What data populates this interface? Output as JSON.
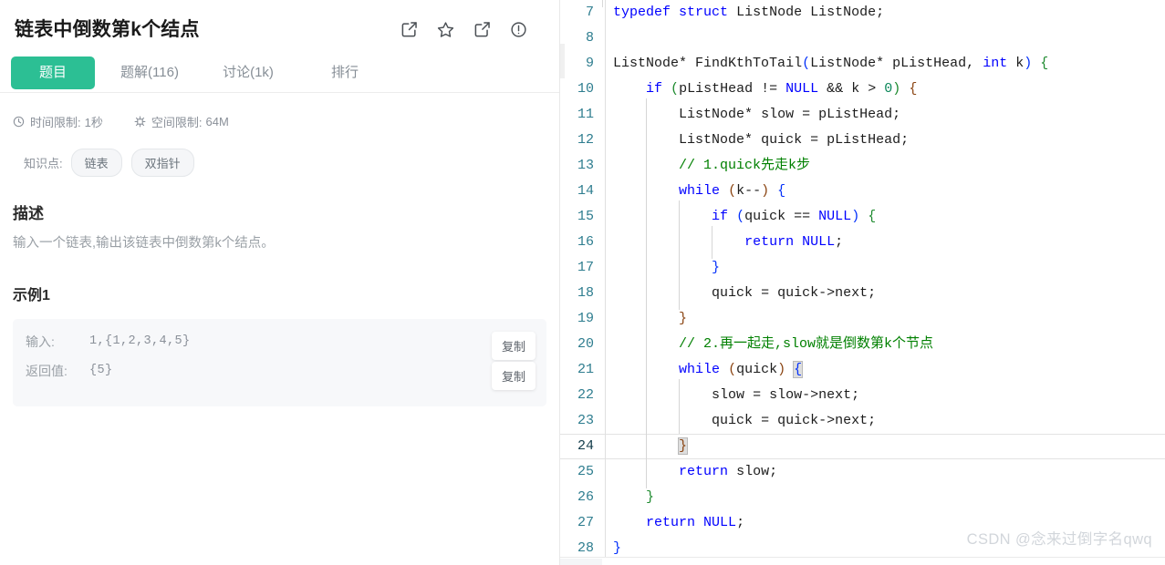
{
  "problem": {
    "title": "链表中倒数第k个结点",
    "header_icons": [
      {
        "name": "edit-icon",
        "label": "编辑"
      },
      {
        "name": "star-icon",
        "label": "收藏"
      },
      {
        "name": "share-icon",
        "label": "分享"
      },
      {
        "name": "info-icon",
        "label": "反馈"
      }
    ],
    "tabs": [
      {
        "label": "题目",
        "active": true
      },
      {
        "label": "题解(116)",
        "active": false
      },
      {
        "label": "讨论(1k)",
        "active": false
      },
      {
        "label": "排行",
        "active": false
      }
    ],
    "meta": [
      {
        "icon": "clock-icon",
        "label": "时间限制:",
        "value": "1秒"
      },
      {
        "icon": "chip-icon",
        "label": "空间限制:",
        "value": "64M"
      }
    ],
    "knowledge": {
      "label": "知识点:",
      "tags": [
        "链表",
        "双指针"
      ]
    },
    "description": {
      "heading": "描述",
      "body": "输入一个链表,输出该链表中倒数第k个结点。"
    },
    "example": {
      "heading": "示例1",
      "rows": [
        {
          "key": "输入:",
          "value": "1,{1,2,3,4,5}",
          "copy_label": "复制"
        },
        {
          "key": "返回值:",
          "value": "{5}",
          "copy_label": "复制"
        }
      ]
    }
  },
  "editor": {
    "language": "c",
    "active_line": 24,
    "accent_color": "#2cbf94",
    "colors": {
      "keyword": "#0000ff",
      "comment": "#008000",
      "number": "#098658",
      "paren_green": "#1d8a2e",
      "paren_blue": "#0431fa",
      "paren_brown": "#8b4513",
      "line_number": "#2e7d8f",
      "plain": "#1c1c1c"
    },
    "lines": [
      {
        "n": 7,
        "code": "typedef struct ListNode ListNode;"
      },
      {
        "n": 8,
        "code": ""
      },
      {
        "n": 9,
        "code": "ListNode* FindKthToTail(ListNode* pListHead, int k) {"
      },
      {
        "n": 10,
        "code": "    if (pListHead != NULL && k > 0) {"
      },
      {
        "n": 11,
        "code": "        ListNode* slow = pListHead;"
      },
      {
        "n": 12,
        "code": "        ListNode* quick = pListHead;"
      },
      {
        "n": 13,
        "code": "        // 1.quick先走k步"
      },
      {
        "n": 14,
        "code": "        while (k--) {"
      },
      {
        "n": 15,
        "code": "            if (quick == NULL) {"
      },
      {
        "n": 16,
        "code": "                return NULL;"
      },
      {
        "n": 17,
        "code": "            }"
      },
      {
        "n": 18,
        "code": "            quick = quick->next;"
      },
      {
        "n": 19,
        "code": "        }"
      },
      {
        "n": 20,
        "code": "        // 2.再一起走,slow就是倒数第k个节点"
      },
      {
        "n": 21,
        "code": "        while (quick) {"
      },
      {
        "n": 22,
        "code": "            slow = slow->next;"
      },
      {
        "n": 23,
        "code": "            quick = quick->next;"
      },
      {
        "n": 24,
        "code": "        }"
      },
      {
        "n": 25,
        "code": "        return slow;"
      },
      {
        "n": 26,
        "code": "    }"
      },
      {
        "n": 27,
        "code": "    return NULL;"
      },
      {
        "n": 28,
        "code": "}"
      }
    ]
  },
  "watermark": "CSDN @念来过倒字名qwq"
}
